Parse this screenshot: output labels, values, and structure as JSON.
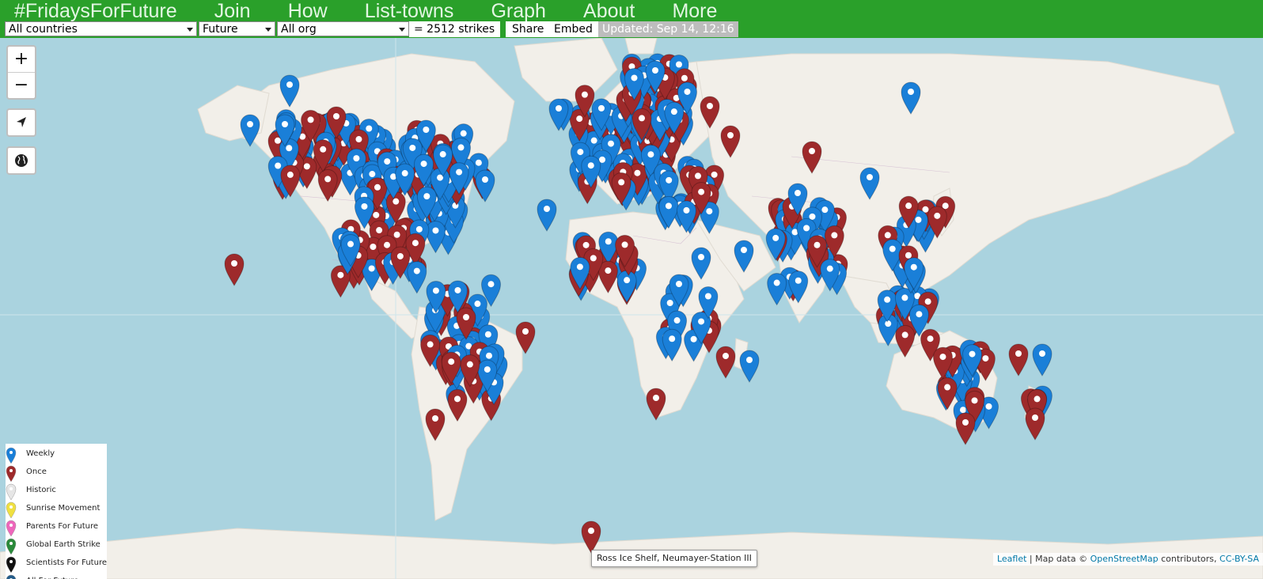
{
  "nav": {
    "brand": "#FridaysForFuture",
    "items": [
      "Join",
      "How",
      "List-towns",
      "Graph",
      "About",
      "More"
    ]
  },
  "controls": {
    "country": "All countries",
    "time": "Future",
    "org": "All org",
    "count": "= 2512 strikes",
    "share": "Share",
    "embed": "Embed",
    "updated": "Updated: Sep 14, 12:16"
  },
  "map_controls": {
    "zoom_in": "+",
    "zoom_out": "−",
    "locate_icon": "navigation-arrow-icon",
    "globe_icon": "globe-icon"
  },
  "legend": [
    {
      "label": "Weekly",
      "color": "#1a7fd8"
    },
    {
      "label": "Once",
      "color": "#9e2a2b"
    },
    {
      "label": "Historic",
      "color": "#e6e6e6"
    },
    {
      "label": "Sunrise Movement",
      "color": "#f0e040"
    },
    {
      "label": "Parents For Future",
      "color": "#ee66bb"
    },
    {
      "label": "Global Earth Strike",
      "color": "#2a8a3a"
    },
    {
      "label": "Scientists For Future",
      "color": "#111111"
    },
    {
      "label": "All For Future",
      "color": "#245c8a"
    }
  ],
  "tooltip": "Ross Ice Shelf, Neumayer-Station III",
  "attribution": {
    "leaflet": "Leaflet",
    "sep": " | Map data © ",
    "osm": "OpenStreetMap",
    "contrib": " contributors, ",
    "license": "CC-BY-SA"
  },
  "colors": {
    "header": "#2aa02a",
    "ocean": "#aad3df",
    "land": "#f2efe9",
    "weekly": "#1a7fd8",
    "once": "#9e2a2b"
  }
}
